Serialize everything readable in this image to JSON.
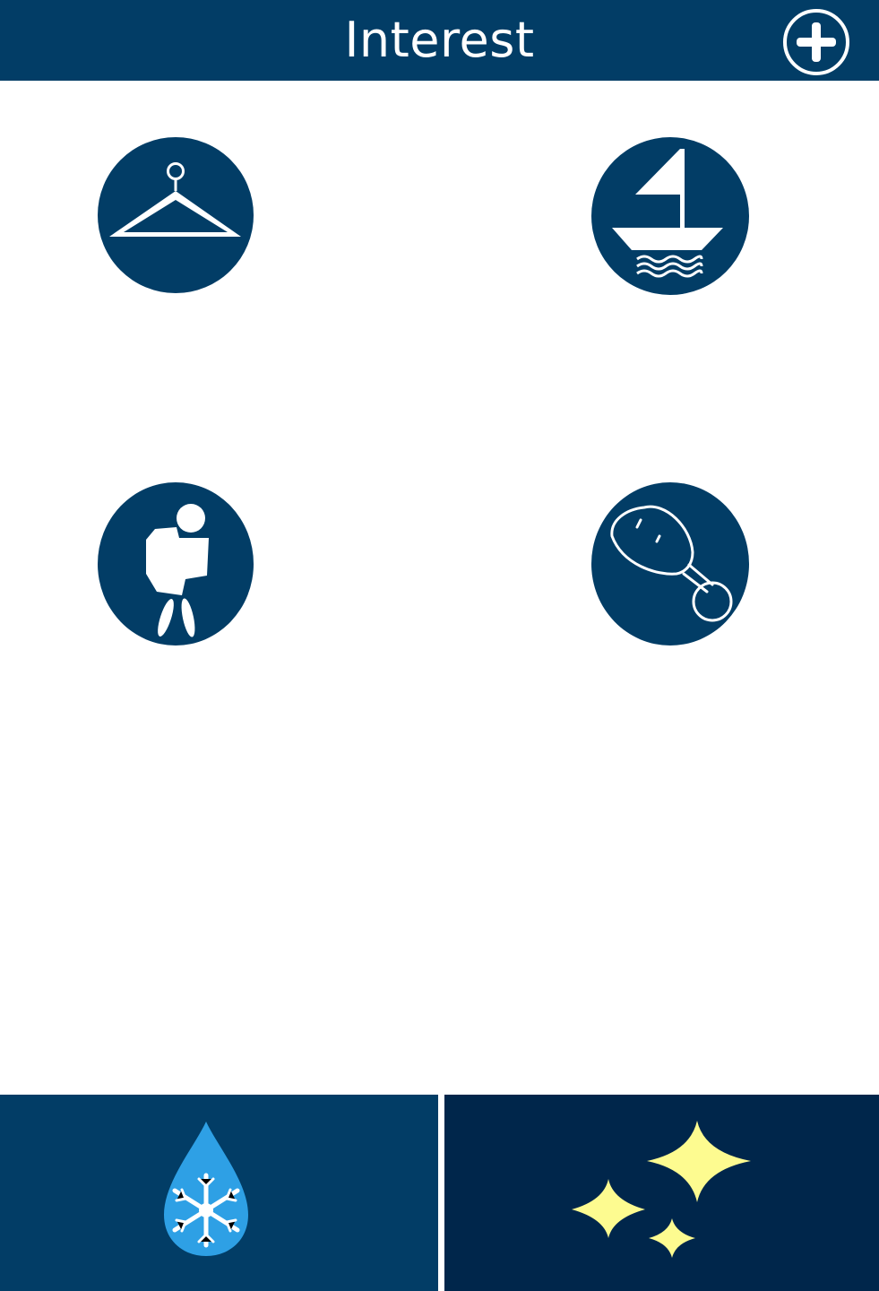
{
  "header": {
    "title": "Interest",
    "add_icon": "plus-circle-icon"
  },
  "colors": {
    "brand_navy": "#023d66",
    "tab_dark_navy": "#00264b",
    "drop_blue": "#2ea0e5",
    "star_yellow": "#fdfb90",
    "background": "#ffffff"
  },
  "interests": [
    {
      "icon": "clothes-hanger-icon"
    },
    {
      "icon": "sailboat-icon"
    },
    {
      "icon": "hiker-backpack-icon"
    },
    {
      "icon": "chicken-drumstick-icon"
    }
  ],
  "bottom_tabs": [
    {
      "icon": "snowflake-drop-icon"
    },
    {
      "icon": "sparkles-icon"
    }
  ]
}
